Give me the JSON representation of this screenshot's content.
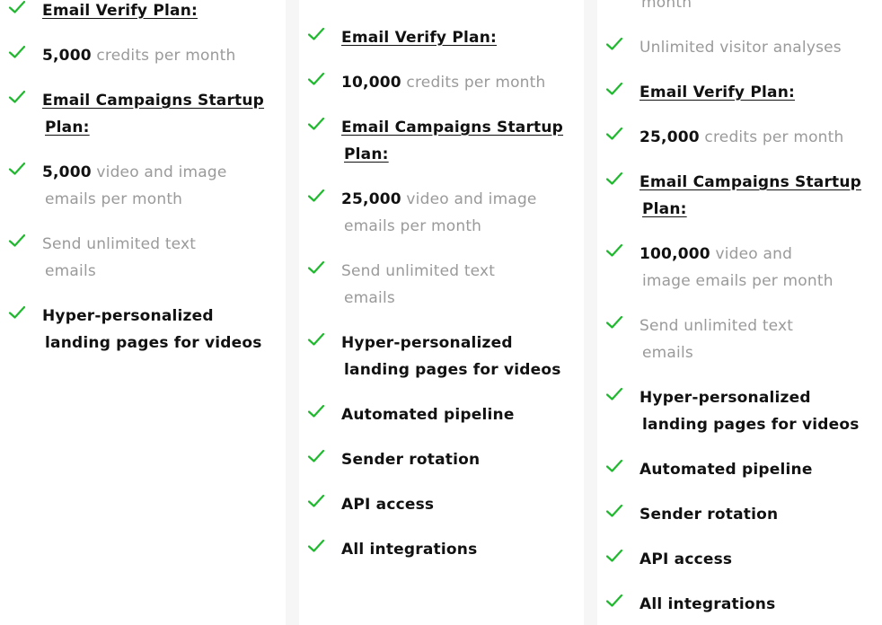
{
  "colors": {
    "check": "#1fb82e",
    "strong_text": "#111111",
    "muted_text": "#9a9a9a",
    "gutter": "#f6f6f6"
  },
  "columns": [
    {
      "items": [
        {
          "icon": "check-icon",
          "parts": [
            {
              "t": "Email Verify Plan:",
              "s": "bu"
            }
          ]
        },
        {
          "icon": "check-icon",
          "parts": [
            {
              "t": "5,000",
              "s": "b"
            },
            {
              "t": " credits per month",
              "s": "g"
            }
          ]
        },
        {
          "icon": "check-icon",
          "lines": [
            [
              {
                "t": "Email Campaigns Startup",
                "s": "bu"
              }
            ],
            [
              {
                "t": "Plan:",
                "s": "bu"
              }
            ]
          ]
        },
        {
          "icon": "check-icon",
          "lines": [
            [
              {
                "t": "5,000",
                "s": "b"
              },
              {
                "t": " video and image",
                "s": "g"
              }
            ],
            [
              {
                "t": "emails per month",
                "s": "g"
              }
            ]
          ]
        },
        {
          "icon": "check-icon",
          "lines": [
            [
              {
                "t": "Send unlimited text",
                "s": "g"
              }
            ],
            [
              {
                "t": "emails",
                "s": "g"
              }
            ]
          ]
        },
        {
          "icon": "check-icon",
          "lines": [
            [
              {
                "t": "Hyper-personalized",
                "s": "b"
              }
            ],
            [
              {
                "t": "landing pages for videos",
                "s": "b"
              }
            ]
          ]
        }
      ]
    },
    {
      "items": [
        {
          "icon": "check-icon",
          "parts": [
            {
              "t": "Email Verify Plan:",
              "s": "bu"
            }
          ]
        },
        {
          "icon": "check-icon",
          "parts": [
            {
              "t": "10,000",
              "s": "b"
            },
            {
              "t": " credits per month",
              "s": "g"
            }
          ]
        },
        {
          "icon": "check-icon",
          "lines": [
            [
              {
                "t": "Email Campaigns Startup",
                "s": "bu"
              }
            ],
            [
              {
                "t": "Plan:",
                "s": "bu"
              }
            ]
          ]
        },
        {
          "icon": "check-icon",
          "lines": [
            [
              {
                "t": "25,000",
                "s": "b"
              },
              {
                "t": " video and image",
                "s": "g"
              }
            ],
            [
              {
                "t": "emails per month",
                "s": "g"
              }
            ]
          ]
        },
        {
          "icon": "check-icon",
          "lines": [
            [
              {
                "t": "Send unlimited text",
                "s": "g"
              }
            ],
            [
              {
                "t": "emails",
                "s": "g"
              }
            ]
          ]
        },
        {
          "icon": "check-icon",
          "lines": [
            [
              {
                "t": "Hyper-personalized",
                "s": "b"
              }
            ],
            [
              {
                "t": "landing pages for videos",
                "s": "b"
              }
            ]
          ]
        },
        {
          "icon": "check-icon",
          "parts": [
            {
              "t": "Automated pipeline",
              "s": "b"
            }
          ]
        },
        {
          "icon": "check-icon",
          "parts": [
            {
              "t": "Sender rotation",
              "s": "b"
            }
          ]
        },
        {
          "icon": "check-icon",
          "parts": [
            {
              "t": "API access",
              "s": "b"
            }
          ]
        },
        {
          "icon": "check-icon",
          "parts": [
            {
              "t": "All integrations",
              "s": "b"
            }
          ]
        }
      ]
    },
    {
      "items": [
        {
          "cont": true,
          "parts": [
            {
              "t": "month",
              "s": "g"
            }
          ]
        },
        {
          "icon": "check-icon",
          "parts": [
            {
              "t": "Unlimited visitor analyses",
              "s": "g"
            }
          ]
        },
        {
          "icon": "check-icon",
          "parts": [
            {
              "t": "Email Verify Plan:",
              "s": "bu"
            }
          ]
        },
        {
          "icon": "check-icon",
          "parts": [
            {
              "t": "25,000",
              "s": "b"
            },
            {
              "t": " credits per month",
              "s": "g"
            }
          ]
        },
        {
          "icon": "check-icon",
          "lines": [
            [
              {
                "t": "Email Campaigns Startup",
                "s": "bu"
              }
            ],
            [
              {
                "t": "Plan:",
                "s": "bu"
              }
            ]
          ]
        },
        {
          "icon": "check-icon",
          "lines": [
            [
              {
                "t": "100,000",
                "s": "b"
              },
              {
                "t": " video and",
                "s": "g"
              }
            ],
            [
              {
                "t": "image emails per month",
                "s": "g"
              }
            ]
          ]
        },
        {
          "icon": "check-icon",
          "lines": [
            [
              {
                "t": "Send unlimited text",
                "s": "g"
              }
            ],
            [
              {
                "t": "emails",
                "s": "g"
              }
            ]
          ]
        },
        {
          "icon": "check-icon",
          "lines": [
            [
              {
                "t": "Hyper-personalized",
                "s": "b"
              }
            ],
            [
              {
                "t": "landing pages for videos",
                "s": "b"
              }
            ]
          ]
        },
        {
          "icon": "check-icon",
          "parts": [
            {
              "t": "Automated pipeline",
              "s": "b"
            }
          ]
        },
        {
          "icon": "check-icon",
          "parts": [
            {
              "t": "Sender rotation",
              "s": "b"
            }
          ]
        },
        {
          "icon": "check-icon",
          "parts": [
            {
              "t": "API access",
              "s": "b"
            }
          ]
        },
        {
          "icon": "check-icon",
          "parts": [
            {
              "t": "All integrations",
              "s": "b"
            }
          ]
        }
      ]
    }
  ]
}
